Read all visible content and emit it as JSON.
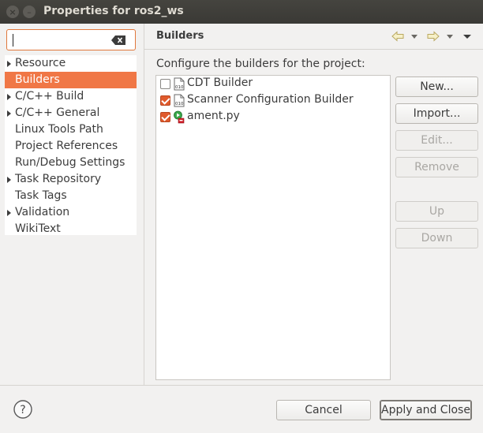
{
  "window": {
    "title": "Properties for ros2_ws",
    "close_glyph": "×",
    "minimize_glyph": "–"
  },
  "filter": {
    "value": "",
    "placeholder": ""
  },
  "tree": {
    "items": [
      {
        "label": "Resource",
        "expandable": true,
        "selected": false
      },
      {
        "label": "Builders",
        "expandable": false,
        "selected": true
      },
      {
        "label": "C/C++ Build",
        "expandable": true,
        "selected": false
      },
      {
        "label": "C/C++ General",
        "expandable": true,
        "selected": false
      },
      {
        "label": "Linux Tools Path",
        "expandable": false,
        "selected": false
      },
      {
        "label": "Project References",
        "expandable": false,
        "selected": false
      },
      {
        "label": "Run/Debug Settings",
        "expandable": false,
        "selected": false
      },
      {
        "label": "Task Repository",
        "expandable": true,
        "selected": false
      },
      {
        "label": "Task Tags",
        "expandable": false,
        "selected": false
      },
      {
        "label": "Validation",
        "expandable": true,
        "selected": false
      },
      {
        "label": "WikiText",
        "expandable": false,
        "selected": false
      }
    ]
  },
  "page": {
    "title": "Builders",
    "description": "Configure the builders for the project:"
  },
  "builders": [
    {
      "name": "CDT Builder",
      "checked": false,
      "icon": "binary-builder-icon"
    },
    {
      "name": "Scanner Configuration Builder",
      "checked": true,
      "icon": "binary-builder-icon"
    },
    {
      "name": "ament.py",
      "checked": true,
      "icon": "external-tool-builder-icon"
    }
  ],
  "buttons": {
    "new": "New...",
    "import": "Import...",
    "edit": "Edit...",
    "remove": "Remove",
    "up": "Up",
    "down": "Down",
    "cancel": "Cancel",
    "apply_close": "Apply and Close",
    "help_glyph": "?"
  },
  "colors": {
    "accent": "#f07746",
    "checkbox": "#e05a2c",
    "titlebar": "#3a3935"
  }
}
